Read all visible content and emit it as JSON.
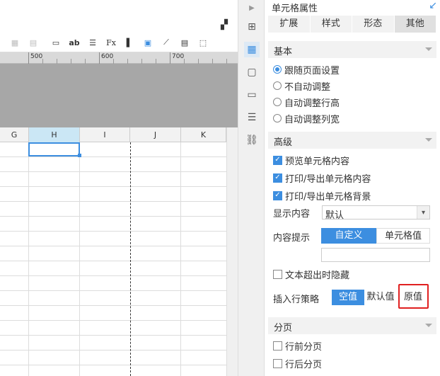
{
  "ruler": {
    "labels": [
      "500",
      "600",
      "700"
    ]
  },
  "columns": [
    "G",
    "H",
    "I",
    "J",
    "K"
  ],
  "panel": {
    "title": "单元格属性",
    "tabs": [
      "扩展",
      "样式",
      "形态",
      "其他"
    ],
    "active_tab": "其他",
    "basic": {
      "title": "基本",
      "options": [
        "跟随页面设置",
        "不自动调整",
        "自动调整行高",
        "自动调整列宽"
      ],
      "selected": "跟随页面设置"
    },
    "advanced": {
      "title": "高级",
      "checkboxes": [
        "预览单元格内容",
        "打印/导出单元格内容",
        "打印/导出单元格背景"
      ],
      "display_label": "显示内容",
      "display_value": "默认",
      "hint_label": "内容提示",
      "hint_options": [
        "自定义",
        "单元格值"
      ],
      "hint_input": "",
      "hide_overflow": "文本超出时隐藏",
      "insert_label": "插入行策略",
      "insert_options": [
        "空值",
        "默认值",
        "原值"
      ]
    },
    "paging": {
      "title": "分页",
      "options": [
        "行前分页",
        "行后分页"
      ]
    }
  },
  "colors": {
    "accent": "#3c8ee0",
    "highlight": "#e02020"
  }
}
